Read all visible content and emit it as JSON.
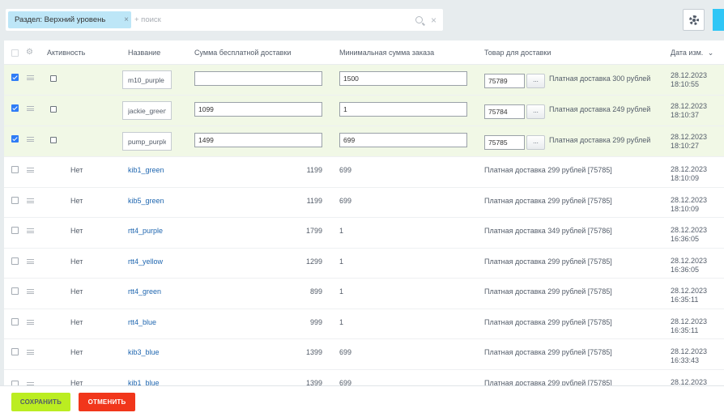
{
  "filter": {
    "chip_label": "Раздел: Верхний уровень",
    "chip_close": "×",
    "search_placeholder": "+ поиск",
    "clear_glyph": "×"
  },
  "grid": {
    "columns": {
      "active": "Активность",
      "name": "Название",
      "free_delivery": "Сумма бесплатной доставки",
      "min_order": "Минимальная сумма заказа",
      "product": "Товар для доставки",
      "date": "Дата изм.",
      "date_sort_glyph": "⌄"
    },
    "edit_rows": [
      {
        "name": "m10_purple",
        "free_delivery": "",
        "min_order": "1500",
        "product_id": "75789",
        "dots": "...",
        "product_name": "Платная доставка 300 рублей",
        "date": "28.12.2023",
        "time": "18:10:55"
      },
      {
        "name": "jackie_green",
        "free_delivery": "1099",
        "min_order": "1",
        "product_id": "75784",
        "dots": "...",
        "product_name": "Платная доставка 249 рублей",
        "date": "28.12.2023",
        "time": "18:10:37"
      },
      {
        "name": "pump_purple",
        "free_delivery": "1499",
        "min_order": "699",
        "product_id": "75785",
        "dots": "...",
        "product_name": "Платная доставка 299 рублей",
        "date": "28.12.2023",
        "time": "18:10:27"
      }
    ],
    "rows": [
      {
        "active": "Нет",
        "name": "kib1_green",
        "free_delivery": "1199",
        "min_order": "699",
        "product": "Платная доставка 299 рублей [75785]",
        "date": "28.12.2023",
        "time": "18:10:09"
      },
      {
        "active": "Нет",
        "name": "kib5_green",
        "free_delivery": "1199",
        "min_order": "699",
        "product": "Платная доставка 299 рублей [75785]",
        "date": "28.12.2023",
        "time": "18:10:09"
      },
      {
        "active": "Нет",
        "name": "rtt4_purple",
        "free_delivery": "1799",
        "min_order": "1",
        "product": "Платная доставка 349 рублей [75786]",
        "date": "28.12.2023",
        "time": "16:36:05"
      },
      {
        "active": "Нет",
        "name": "rtt4_yellow",
        "free_delivery": "1299",
        "min_order": "1",
        "product": "Платная доставка 299 рублей [75785]",
        "date": "28.12.2023",
        "time": "16:36:05"
      },
      {
        "active": "Нет",
        "name": "rtt4_green",
        "free_delivery": "899",
        "min_order": "1",
        "product": "Платная доставка 299 рублей [75785]",
        "date": "28.12.2023",
        "time": "16:35:11"
      },
      {
        "active": "Нет",
        "name": "rtt4_blue",
        "free_delivery": "999",
        "min_order": "1",
        "product": "Платная доставка 299 рублей [75785]",
        "date": "28.12.2023",
        "time": "16:35:11"
      },
      {
        "active": "Нет",
        "name": "kib3_blue",
        "free_delivery": "1399",
        "min_order": "699",
        "product": "Платная доставка 299 рублей [75785]",
        "date": "28.12.2023",
        "time": "16:33:43"
      },
      {
        "active": "Нет",
        "name": "kib1_blue",
        "free_delivery": "1399",
        "min_order": "699",
        "product": "Платная доставка 299 рублей [75785]",
        "date": "28.12.2023",
        "time": ""
      }
    ]
  },
  "buttons": {
    "save": "СОХРАНИТЬ",
    "cancel": "ОТМЕНИТЬ"
  },
  "colors": {
    "edit_row_bg": "#f1f8e6",
    "link": "#2067b0",
    "save_bg": "#bbed21",
    "cancel_bg": "#f1361b",
    "accent_blue": "#2fc6f6"
  }
}
